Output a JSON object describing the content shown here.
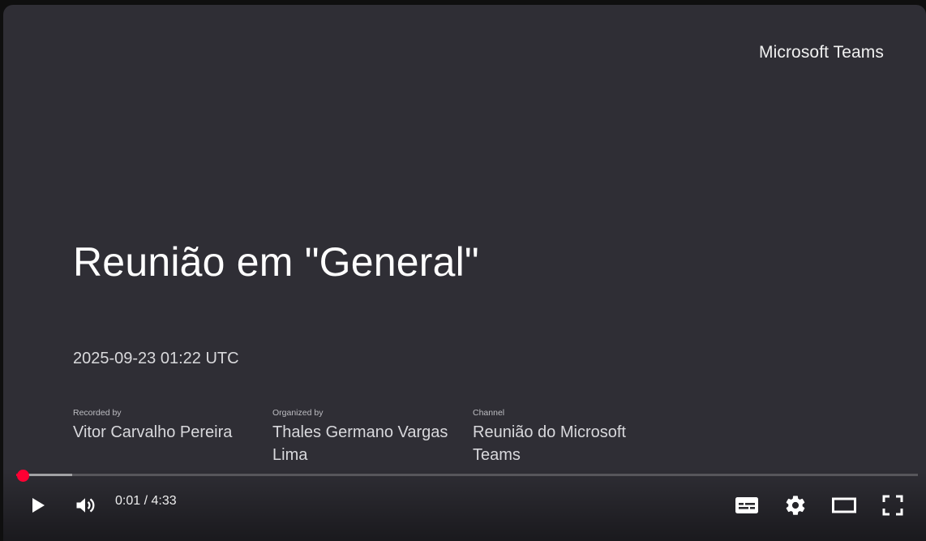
{
  "video": {
    "brand": "Microsoft Teams",
    "title": "Reunião em \"General\"",
    "datetime": "2025-09-23 01:22 UTC",
    "recorded_by": {
      "label": "Recorded by",
      "value": "Vitor Carvalho Pereira"
    },
    "organized_by": {
      "label": "Organized by",
      "value": "Thales Germano Vargas Lima"
    },
    "channel": {
      "label": "Channel",
      "value": "Reunião do Microsoft Teams"
    }
  },
  "player": {
    "current_time": "0:01",
    "separator": " / ",
    "duration": "4:33",
    "played_fraction": 0.004,
    "buffered_fraction": 0.062,
    "accent_color": "#ff0033",
    "icons": {
      "play": "play-icon",
      "volume": "volume-icon",
      "subtitles": "subtitles-icon",
      "settings": "settings-icon",
      "theater": "theater-mode-icon",
      "fullscreen": "fullscreen-icon"
    }
  }
}
